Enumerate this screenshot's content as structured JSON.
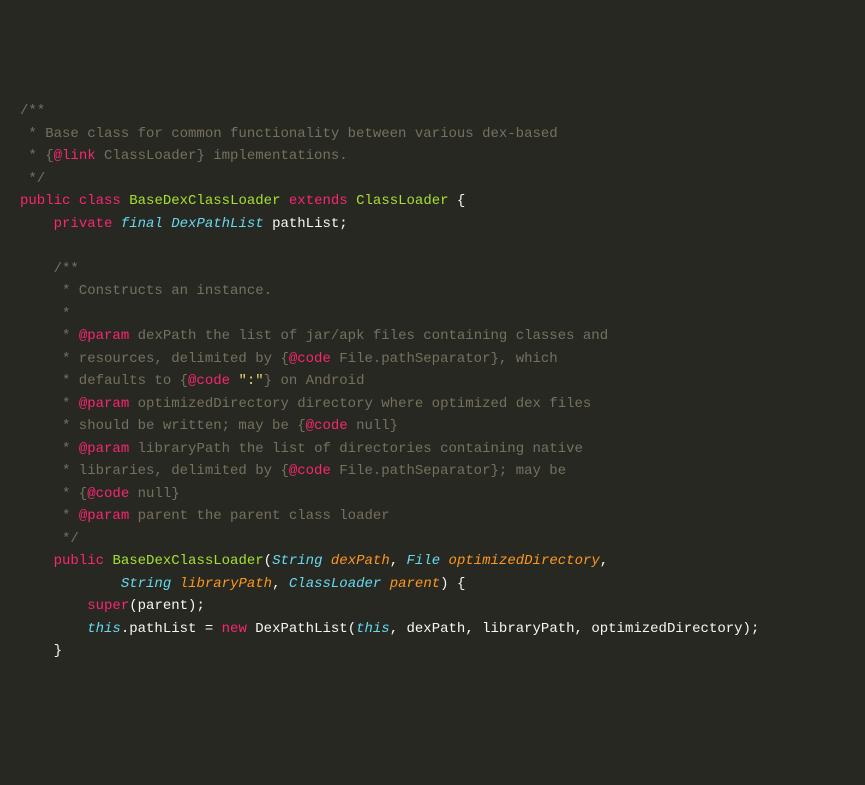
{
  "code": {
    "l1": "/**",
    "l2a": " * Base class for common functionality between various dex-based",
    "l3a": " * {",
    "l3tag": "@link",
    "l3b": " ClassLoader} implementations.",
    "l4": " */",
    "l5_public": "public",
    "l5_class": "class",
    "l5_name": "BaseDexClassLoader",
    "l5_extends": "extends",
    "l5_super": "ClassLoader",
    "l5_brace": " {",
    "l6_private": "private",
    "l6_final": "final",
    "l6_type": "DexPathList",
    "l6_rest": " pathList;",
    "l7_blank": "",
    "l8": "    /**",
    "l9": "     * Constructs an instance.",
    "l10": "     *",
    "l11a": "     * ",
    "l11tag": "@param",
    "l11b": " dexPath the list of jar/apk files containing classes and",
    "l12a": "     * resources, delimited by {",
    "l12tag": "@code",
    "l12b": " File.pathSeparator}, which",
    "l13a": "     * defaults to {",
    "l13tag": "@code",
    "l13str": " \":\"",
    "l13b": "} on Android",
    "l14a": "     * ",
    "l14tag": "@param",
    "l14b": " optimizedDirectory directory where optimized dex files",
    "l15a": "     * should be written; may be {",
    "l15tag": "@code",
    "l15b": " null}",
    "l16a": "     * ",
    "l16tag": "@param",
    "l16b": " libraryPath the list of directories containing native",
    "l17a": "     * libraries, delimited by {",
    "l17tag": "@code",
    "l17b": " File.pathSeparator}; may be",
    "l18a": "     * {",
    "l18tag": "@code",
    "l18b": " null}",
    "l19a": "     * ",
    "l19tag": "@param",
    "l19b": " parent the parent class loader",
    "l20": "     */",
    "l21_public": "public",
    "l21_func": "BaseDexClassLoader",
    "l21_p1t": "String",
    "l21_p1n": "dexPath",
    "l21_p2t": "File",
    "l21_p2n": "optimizedDirectory",
    "l22_p3t": "String",
    "l22_p3n": "libraryPath",
    "l22_p4t": "ClassLoader",
    "l22_p4n": "parent",
    "l22_end": ") {",
    "l23_super": "super",
    "l23_rest": "(parent);",
    "l24_this": "this",
    "l24_a": ".pathList = ",
    "l24_new": "new",
    "l24_ctor": " DexPathList(",
    "l24_this2": "this",
    "l24_rest": ", dexPath, libraryPath, optimizedDirectory);",
    "l25": "    }"
  }
}
